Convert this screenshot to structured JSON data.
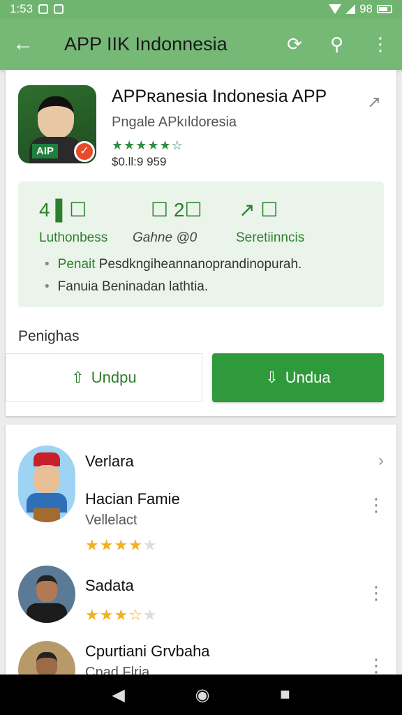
{
  "status_bar": {
    "time": "1:53",
    "battery_text": "98"
  },
  "app_bar": {
    "title": "APP IIK Indonnesia"
  },
  "app": {
    "name": "APPʀanesia Indonesia APP",
    "developer": "Pngale APkıldoresia",
    "stars": "★★★★★☆",
    "price": "$0.ƖƖ:9 959",
    "icon_label": "AIP"
  },
  "stats": [
    {
      "icon": "4 ▌☐",
      "label": "Luthonbess"
    },
    {
      "icon": "☐ 2☐",
      "label": "Gahne @0"
    },
    {
      "icon": "↗ ☐",
      "label": "Seretiinncis"
    }
  ],
  "bullets": [
    {
      "highlight": "Penait",
      "text": " Pesdkngiheannanoprandinopurah."
    },
    {
      "highlight": "",
      "text": "Fanuia Beninadan lathtia."
    }
  ],
  "section_label": "Penighas",
  "buttons": {
    "secondary": "Undpu",
    "primary": "Undua"
  },
  "reviews": [
    {
      "name": "Verlara",
      "subtitle": ""
    },
    {
      "name": "Hacian Famie",
      "subtitle": "Vellelact",
      "rating": 4
    },
    {
      "name": "Sadata",
      "subtitle": "",
      "rating": 3.5
    },
    {
      "name": "Cpurtiani Grvbaha",
      "subtitle": "Cpad Flria"
    }
  ],
  "colors": {
    "accent": "#2f9a3c",
    "app_bar": "#76b876",
    "star": "#f2b21d"
  }
}
